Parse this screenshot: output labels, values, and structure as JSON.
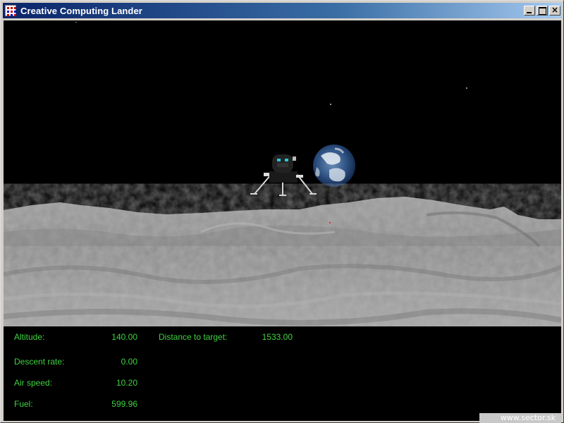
{
  "window": {
    "title": "Creative Computing Lander",
    "icon": "app-grid-icon"
  },
  "hud": {
    "altitude_label": "Altitude:",
    "altitude_value": "140.00",
    "distance_label": "Distance to target:",
    "distance_value": "1533.00",
    "descent_label": "Descent rate:",
    "descent_value": "0.00",
    "airspeed_label": "Air speed:",
    "airspeed_value": "10.20",
    "fuel_label": "Fuel:",
    "fuel_value": "599.96",
    "color": "#3fd23f"
  },
  "watermark": "www.sector.sk"
}
